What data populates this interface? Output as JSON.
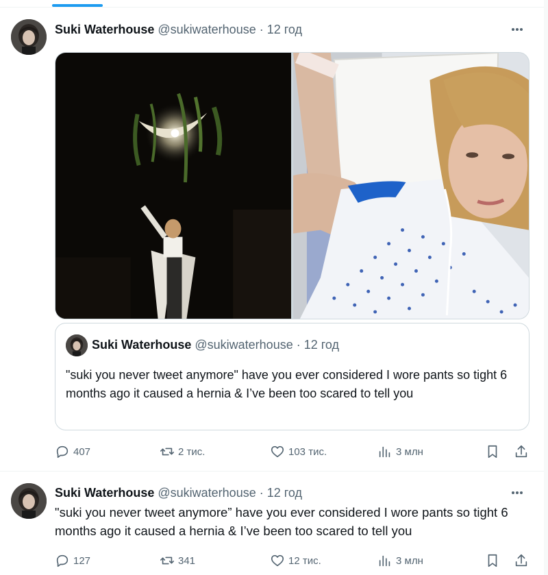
{
  "tweets": [
    {
      "author": {
        "name": "Suki Waterhouse",
        "handle": "@sukiwaterhouse",
        "time": "12 год"
      },
      "media": [
        {
          "icon": "concert-photo"
        },
        {
          "icon": "hospital-selfie-photo"
        }
      ],
      "quote": {
        "author": {
          "name": "Suki Waterhouse",
          "handle": "@sukiwaterhouse",
          "time": "12 год"
        },
        "text": "\"suki you never tweet anymore\" have you ever considered I wore pants so tight 6 months ago it caused a hernia & I’ve been too scared to tell you"
      },
      "stats": {
        "replies": "407",
        "reposts": "2 тис.",
        "likes": "103 тис.",
        "views": "3 млн"
      }
    },
    {
      "author": {
        "name": "Suki Waterhouse",
        "handle": "@sukiwaterhouse",
        "time": "12 год"
      },
      "text": "\"suki you never tweet anymore” have you ever considered I wore pants so tight 6 months ago it caused a hernia & I’ve been too scared to tell you",
      "stats": {
        "replies": "127",
        "reposts": "341",
        "likes": "12 тис.",
        "views": "3 млн"
      }
    }
  ],
  "ui": {
    "separator": "·",
    "accent": "#1d9bf0",
    "text_secondary": "#536471"
  }
}
